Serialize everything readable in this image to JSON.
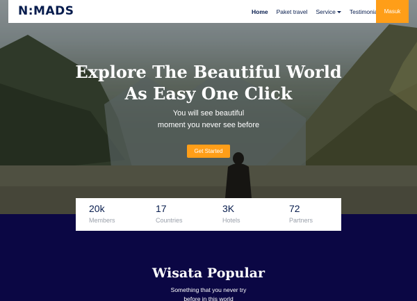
{
  "brand": {
    "logo_text": "N:MADS"
  },
  "nav": {
    "links": [
      {
        "label": "Home"
      },
      {
        "label": "Paket travel"
      },
      {
        "label": "Service"
      },
      {
        "label": "Testimonial"
      }
    ],
    "login_label": "Masuk"
  },
  "hero": {
    "title_line1": "Explore The Beautiful World",
    "title_line2": "As Easy One Click",
    "subtitle_line1": "You will see beautiful",
    "subtitle_line2": "moment you never see before",
    "cta_label": "Get Started"
  },
  "stats": [
    {
      "value": "20k",
      "label": "Members"
    },
    {
      "value": "17",
      "label": "Countries"
    },
    {
      "value": "3K",
      "label": "Hotels"
    },
    {
      "value": "72",
      "label": "Partners"
    }
  ],
  "popular": {
    "title": "Wisata Popular",
    "subtitle_line1": "Something that you never try",
    "subtitle_line2": "before in this world"
  },
  "colors": {
    "accent": "#ff9e18",
    "navy_text": "#071c4d",
    "section_bg": "#0b0744"
  }
}
